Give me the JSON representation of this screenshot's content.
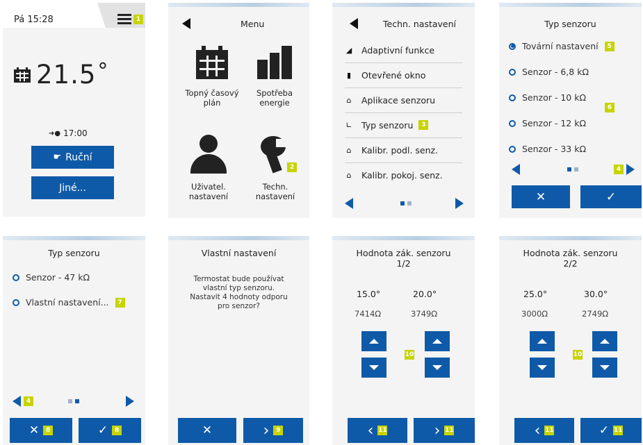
{
  "s1": {
    "clock": "Pá 15:28",
    "badge_menu": "1",
    "temperature": "21.5",
    "degree": "°",
    "next_time": "17:00",
    "btn_manual": "Ruční",
    "btn_other": "Jiné..."
  },
  "s2": {
    "title": "Menu",
    "items": [
      "Topný časový plán",
      "Spotřeba energie",
      "Uživatel. nastavení",
      "Techn. nastavení"
    ],
    "badge": "2"
  },
  "s3": {
    "title": "Techn. nastavení",
    "items": [
      "Adaptivní funkce",
      "Otevřené okno",
      "Aplikace senzoru",
      "Typ senzoru",
      "Kalibr. podl. senz.",
      "Kalibr. pokoj. senz."
    ],
    "badge": "3"
  },
  "s4": {
    "title": "Typ senzoru",
    "options": [
      "Tovární nastavení",
      "Senzor - 6,8 kΩ",
      "Senzor - 10 kΩ",
      "Senzor - 12 kΩ",
      "Senzor - 33 kΩ"
    ],
    "badge_factory": "5",
    "badge_list": "6",
    "badge_next": "4",
    "cancel": "✕",
    "ok": "✓"
  },
  "s5": {
    "title": "Typ senzoru",
    "options": [
      "Senzor - 47 kΩ",
      "Vlastní nastavení..."
    ],
    "badge_custom": "7",
    "badge_prev": "4",
    "badge_cancel": "8",
    "badge_ok": "8",
    "cancel": "✕",
    "ok": "✓"
  },
  "s6": {
    "title": "Vlastní nastavení",
    "message": "Termostat bude používat vlastní typ senzoru. Nastavit 4 hodnoty odporu pro senzor?",
    "badge_next": "9",
    "cancel": "✕",
    "next": "›"
  },
  "s7": {
    "title": "Hodnota zák. senzoru",
    "page": "1/2",
    "temp1": "15.0°",
    "temp2": "20.0°",
    "res1": "7414Ω",
    "res2": "3749Ω",
    "badge_adjust": "10",
    "badge_back": "11",
    "badge_next": "11",
    "back": "‹",
    "next": "›"
  },
  "s8": {
    "title": "Hodnota zák. senzoru",
    "page": "2/2",
    "temp1": "25.0°",
    "temp2": "30.0°",
    "res1": "3000Ω",
    "res2": "2749Ω",
    "badge_adjust": "10",
    "badge_back": "11",
    "badge_ok": "11",
    "back": "‹",
    "ok": "✓"
  },
  "colors": {
    "accent": "#0f5aa8",
    "badge": "#c7d400",
    "screen_bg": "#f4f4f4"
  }
}
